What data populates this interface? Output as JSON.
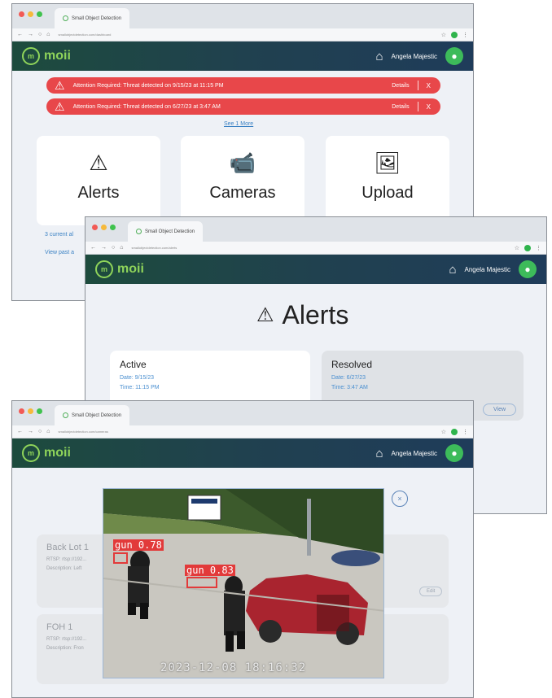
{
  "browser": {
    "tab_title": "Small Object Detection",
    "urls": [
      "smallobjectdetection.com/dashboard",
      "smallobjectdetection.com/alerts",
      "smallobjectdetection.com/cameras"
    ]
  },
  "nav": {
    "brand": "moii",
    "brand_mark": "m",
    "user_name": "Angela Majestic",
    "avatar_icon": "user-icon",
    "home_icon": "home-icon"
  },
  "dashboard": {
    "alerts": [
      {
        "text": "Attention Required: Threat detected on 9/15/23 at 11:15 PM",
        "details": "Details",
        "close": "X"
      },
      {
        "text": "Attention Required: Threat detected on 6/27/23 at 3:47 AM",
        "details": "Details",
        "close": "X"
      }
    ],
    "see_more": "See 1 More",
    "cards": [
      {
        "label": "Alerts",
        "icon": "warning-icon"
      },
      {
        "label": "Cameras",
        "icon": "security-camera-icon"
      },
      {
        "label": "Upload",
        "icon": "upload-image-icon"
      }
    ],
    "current_alerts": "3 current al",
    "view_past": "View past a"
  },
  "alerts_page": {
    "title": "Alerts",
    "active": {
      "heading": "Active",
      "date": "Date: 9/15/23",
      "time": "Time: 11:15 PM"
    },
    "resolved": {
      "heading": "Resolved",
      "date": "Date: 6/27/23",
      "time": "Time: 3:47 AM",
      "view": "View"
    }
  },
  "cameras_page": {
    "cameras": [
      {
        "name": "Back Lot 1",
        "rtsp": "RTSP: rtsp://192...",
        "description": "Description: Left"
      },
      {
        "name": "FOH 1",
        "rtsp": "RTSP: rtsp://192...",
        "description": "Description: Fron"
      }
    ],
    "edit": "Edit",
    "close": "×",
    "detections": [
      {
        "label": "gun",
        "score": "0.78"
      },
      {
        "label": "gun",
        "score": "0.83"
      }
    ],
    "timestamp": "2023-12-08 18:16:32"
  },
  "colors": {
    "alert_red": "#e8474a",
    "brand_green": "#8fd45a",
    "link_blue": "#3b82c4",
    "nav_dark": "#1f3c5a"
  }
}
